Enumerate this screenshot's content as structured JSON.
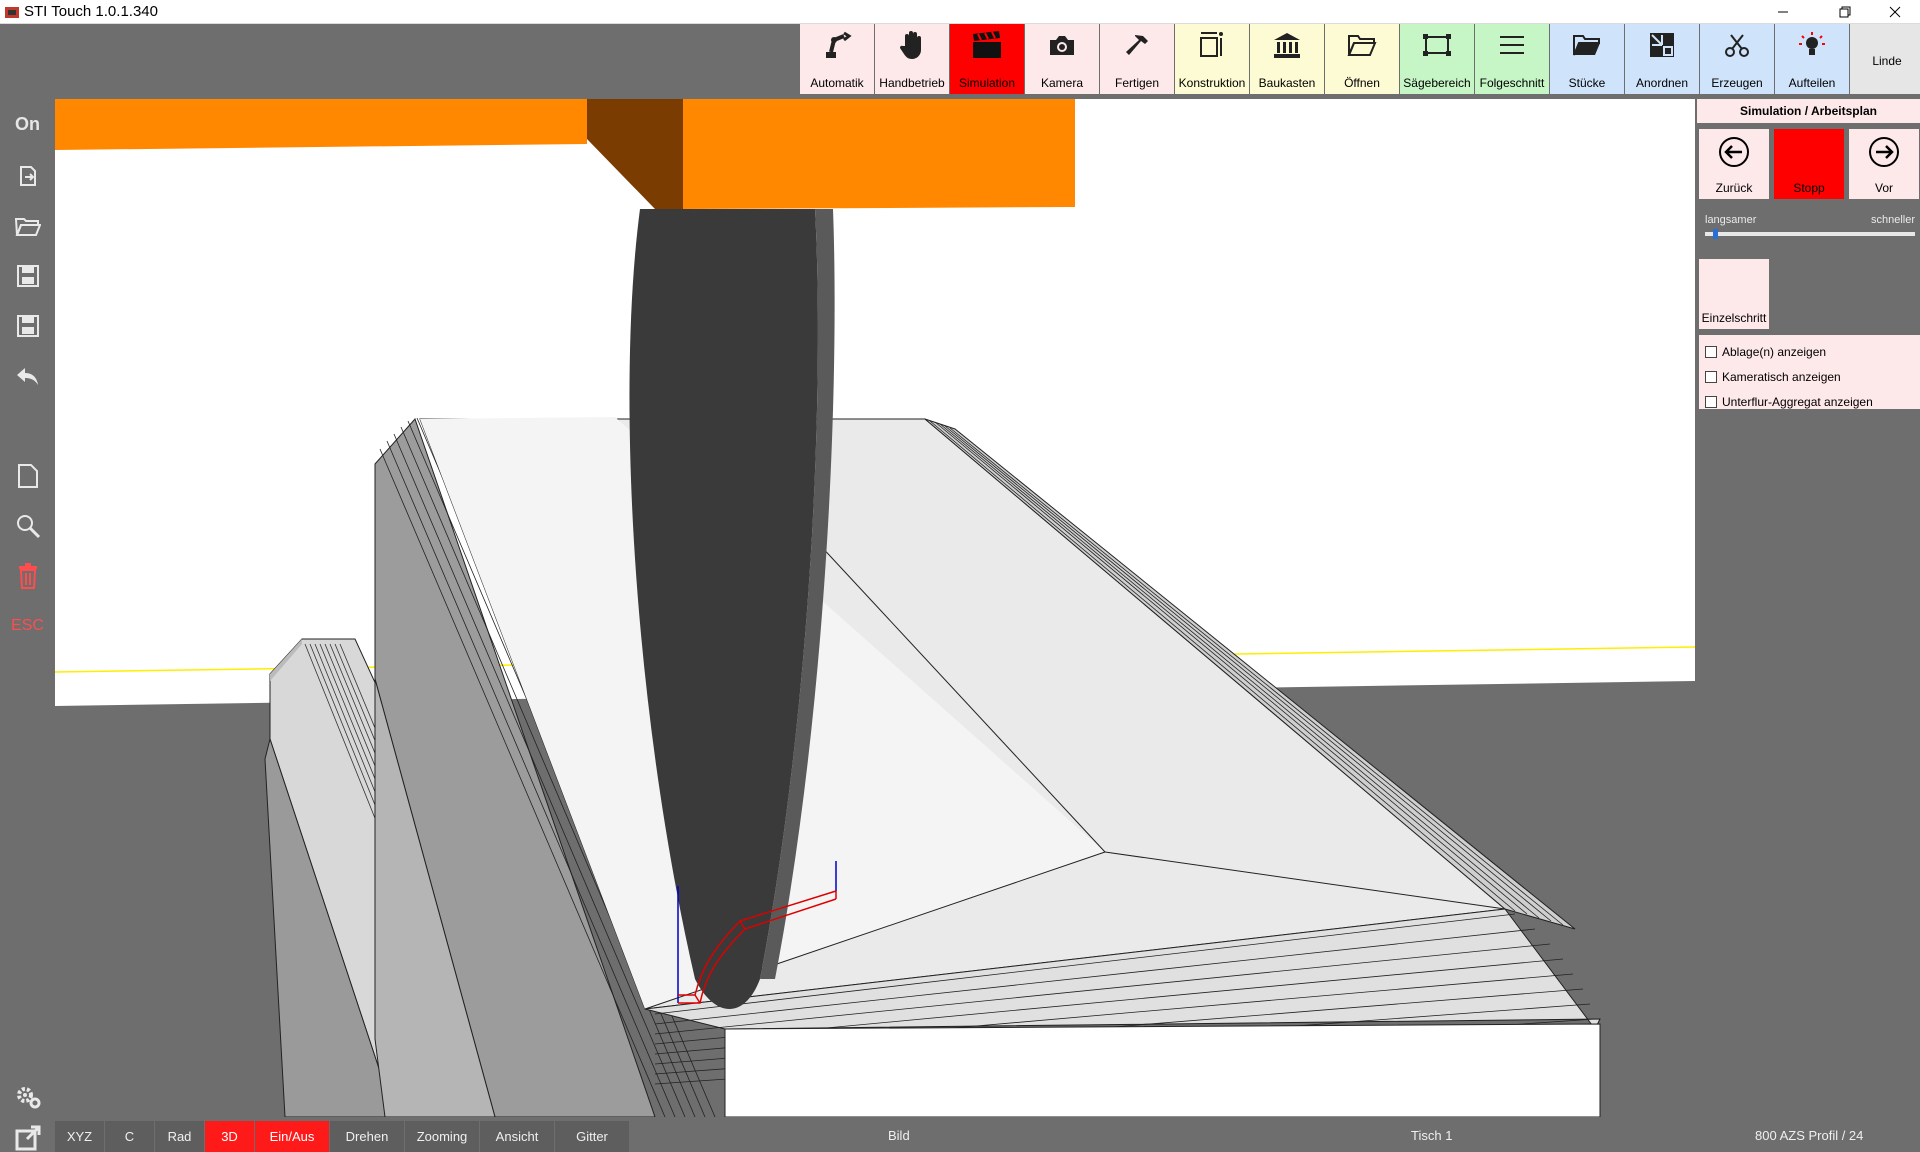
{
  "window": {
    "title": "STI Touch 1.0.1.340"
  },
  "sidebar": {
    "on_label": "On",
    "esc_label": "ESC",
    "icons": [
      "export-icon",
      "folder-open-icon",
      "save-icon",
      "save-as-icon",
      "undo-icon",
      "new-document-icon",
      "search-icon",
      "trash-icon",
      "settings-icon",
      "external-link-icon"
    ]
  },
  "toolbar": {
    "items": [
      {
        "label": "Automatik",
        "icon": "robot-arm-icon",
        "color": "#fde8ea"
      },
      {
        "label": "Handbetrieb",
        "icon": "hand-icon",
        "color": "#fde8ea"
      },
      {
        "label": "Simulation",
        "icon": "clapperboard-icon",
        "color": "#ff0000",
        "active": true
      },
      {
        "label": "Kamera",
        "icon": "camera-icon",
        "color": "#fde8ea"
      },
      {
        "label": "Fertigen",
        "icon": "hammer-icon",
        "color": "#fde8ea"
      },
      {
        "label": "Konstruktion",
        "icon": "construction-icon",
        "color": "#fdfbd4"
      },
      {
        "label": "Baukasten",
        "icon": "building-icon",
        "color": "#fdfbd4"
      },
      {
        "label": "Öffnen",
        "icon": "folder-icon",
        "color": "#fdfbd4"
      },
      {
        "label": "Sägebereich",
        "icon": "saw-area-icon",
        "color": "#c6f5c6"
      },
      {
        "label": "Folgeschnitt",
        "icon": "list-icon",
        "color": "#c6f5c6"
      },
      {
        "label": "Stücke",
        "icon": "pieces-folder-icon",
        "color": "#cfe3fb"
      },
      {
        "label": "Anordnen",
        "icon": "arrange-icon",
        "color": "#cfe3fb"
      },
      {
        "label": "Erzeugen",
        "icon": "scissors-icon",
        "color": "#cfe3fb"
      },
      {
        "label": "Aufteilen",
        "icon": "lightbulb-icon",
        "color": "#cfe3fb"
      },
      {
        "label": "Linde",
        "icon": "",
        "color": "#e6e6e6"
      }
    ]
  },
  "panel": {
    "title": "Simulation / Arbeitsplan",
    "nav": {
      "back_label": "Zurück",
      "stop_label": "Stopp",
      "forward_label": "Vor"
    },
    "speed": {
      "slow_label": "langsamer",
      "fast_label": "schneller",
      "value": 0.04
    },
    "single_step_label": "Einzelschritt",
    "checkboxes": [
      {
        "label": "Ablage(n) anzeigen",
        "checked": false
      },
      {
        "label": "Kameratisch anzeigen",
        "checked": false
      },
      {
        "label": "Unterflur-Aggregat anzeigen",
        "checked": false
      }
    ]
  },
  "bottombar": {
    "buttons": [
      {
        "label": "XYZ",
        "active": false
      },
      {
        "label": "C",
        "active": false
      },
      {
        "label": "Rad",
        "active": false
      },
      {
        "label": "3D",
        "active": true
      },
      {
        "label": "Ein/Aus",
        "active": true
      },
      {
        "label": "Drehen",
        "active": false
      },
      {
        "label": "Zooming",
        "active": false
      },
      {
        "label": "Ansicht",
        "active": false
      },
      {
        "label": "Gitter",
        "active": false
      }
    ],
    "status_image": "Bild",
    "status_table": "Tisch 1",
    "status_profile": "800 AZS Profil / 24"
  },
  "colors": {
    "accent_red": "#ff0000",
    "tool_orange": "#ff8800",
    "workpiece": "#e8e8e8"
  }
}
